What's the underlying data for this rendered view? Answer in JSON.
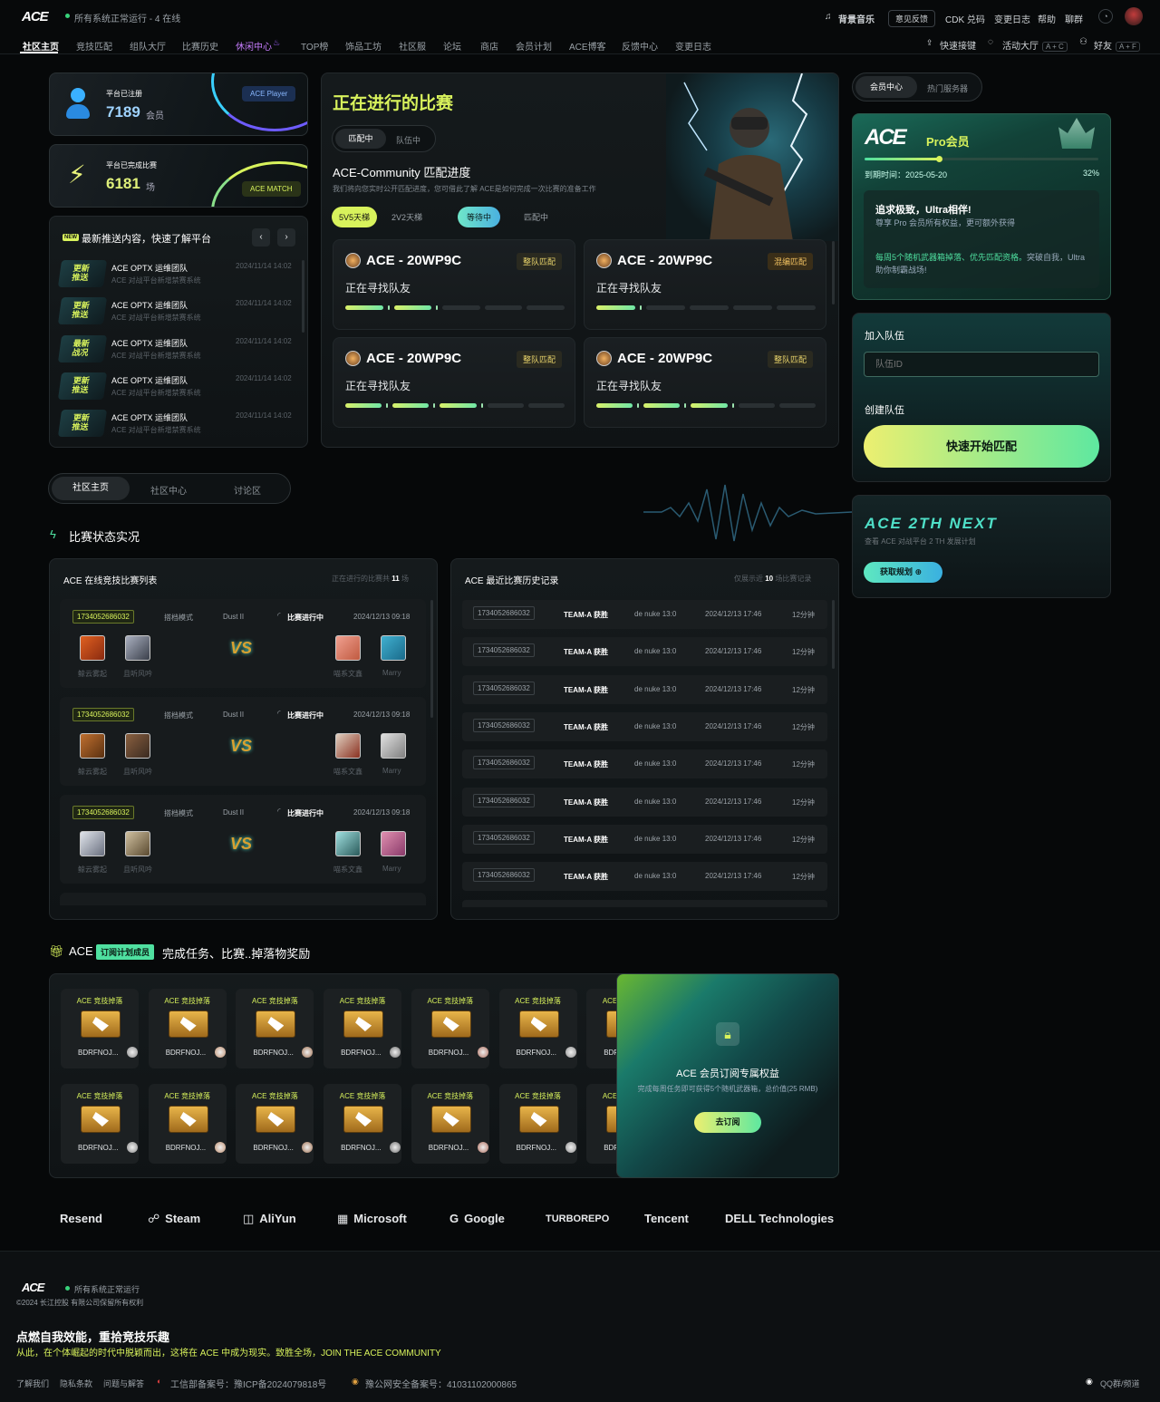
{
  "header": {
    "logo": "ACE",
    "status": "所有系统正常运行 - 4 在线",
    "music": "背景音乐",
    "feedback": "意见反馈",
    "cdk": "CDK 兑码",
    "changelog": "变更日志",
    "help": "帮助",
    "chat": "聊群",
    "shortcut": "快速接键",
    "lobby": "活动大厅",
    "lobby_key": "A + C",
    "friends": "好友",
    "friends_key": "A + F",
    "nav": [
      "社区主页",
      "竞技匹配",
      "组队大厅",
      "比赛历史",
      "休闲中心",
      "TOP榜",
      "饰品工坊",
      "社区服",
      "论坛",
      "商店",
      "会员计划",
      "ACE博客",
      "反馈中心",
      "变更日志"
    ]
  },
  "stats": {
    "registered_label": "平台已注册",
    "registered_value": "7189",
    "registered_unit": "会员",
    "registered_tag": "ACE Player",
    "matches_label": "平台已完成比赛",
    "matches_value": "6181",
    "matches_unit": "场",
    "matches_tag": "ACE MATCH"
  },
  "news": {
    "new_badge": "NEW",
    "title": "最新推送内容，快速了解平台",
    "items": [
      {
        "thumb": "更新推送",
        "org": "ACE OPTX 运维团队",
        "desc": "ACE 对战平台新增禁赛系统",
        "date": "2024/11/14 14:02"
      },
      {
        "thumb": "更新推送",
        "org": "ACE OPTX 运维团队",
        "desc": "ACE 对战平台新增禁赛系统",
        "date": "2024/11/14 14:02"
      },
      {
        "thumb": "最新战况",
        "org": "ACE OPTX 运维团队",
        "desc": "ACE 对战平台新增禁赛系统",
        "date": "2024/11/14 14:02"
      },
      {
        "thumb": "更新推送",
        "org": "ACE OPTX 运维团队",
        "desc": "ACE 对战平台新增禁赛系统",
        "date": "2024/11/14 14:02"
      },
      {
        "thumb": "更新推送",
        "org": "ACE OPTX 运维团队",
        "desc": "ACE 对战平台新增禁赛系统",
        "date": "2024/11/14 14:02"
      }
    ]
  },
  "live": {
    "title": "正在进行的比赛",
    "tab1": "匹配中",
    "tab2": "队伍中",
    "subtitle": "ACE-Community 匹配进度",
    "desc": "我们将向您实时公开匹配进度，您可借此了解 ACE是如何完成一次比赛的准备工作",
    "mode1": "5V5天梯",
    "mode2": "2V2天梯",
    "state1": "等待中",
    "state2": "匹配中",
    "cards": [
      {
        "title": "ACE - 20WP9C",
        "badge": "整队匹配",
        "sub": "正在寻找队友",
        "on": [
          1,
          1,
          0,
          0,
          0
        ],
        "ticks": 2
      },
      {
        "title": "ACE - 20WP9C",
        "badge": "混编匹配",
        "sub": "正在寻找队友",
        "on": [
          1,
          0,
          0,
          0,
          0
        ],
        "ticks": 1
      },
      {
        "title": "ACE - 20WP9C",
        "badge": "整队匹配",
        "sub": "正在寻找队友",
        "on": [
          1,
          1,
          1,
          0,
          0
        ],
        "ticks": 3
      },
      {
        "title": "ACE - 20WP9C",
        "badge": "整队匹配",
        "sub": "正在寻找队友",
        "on": [
          1,
          1,
          1,
          0,
          0
        ],
        "ticks": 3
      }
    ]
  },
  "side": {
    "tab1": "会员中心",
    "tab2": "热门服务器",
    "pro_label": "Pro会员",
    "expire": "到期时间：2025-05-20",
    "percent": "32%",
    "progress": 0.32,
    "promo_title": "追求极致，Ultra相伴!",
    "promo_desc": "尊享 Pro 会员所有权益，更可额外获得",
    "promo_hl": "每周5个随机武器箱掉落、优先匹配资格。",
    "promo_tail": "突破自我，Ultra助你制霸战场!",
    "join_label": "加入队伍",
    "team_placeholder": "队伍ID",
    "create_label": "创建队伍",
    "quick_btn": "快速开始匹配",
    "next_title": "ACE 2TH NEXT",
    "next_desc": "查看 ACE 对战平台 2 TH 发展计划",
    "next_btn": "获取规划"
  },
  "tabs": [
    "社区主页",
    "社区中心",
    "讨论区"
  ],
  "section_title": "比赛状态实况",
  "online_list": {
    "title": "ACE 在线竞技比赛列表",
    "count_prefix": "正在进行的比赛共",
    "count": "11",
    "count_suffix": "场",
    "rows": [
      {
        "id": "1734052686032",
        "mode": "搭档模式",
        "map": "Dust II",
        "state": "比赛进行中",
        "time": "2024/12/13 09:18",
        "p1": "鲸云雾起",
        "p2": "且听风吟",
        "p3": "喵系文鑫",
        "p4": "Marry"
      },
      {
        "id": "1734052686032",
        "mode": "搭档模式",
        "map": "Dust II",
        "state": "比赛进行中",
        "time": "2024/12/13 09:18",
        "p1": "鲸云雾起",
        "p2": "且听风吟",
        "p3": "喵系文鑫",
        "p4": "Marry"
      },
      {
        "id": "1734052686032",
        "mode": "搭档模式",
        "map": "Dust II",
        "state": "比赛进行中",
        "time": "2024/12/13 09:18",
        "p1": "鲸云雾起",
        "p2": "且听风吟",
        "p3": "喵系文鑫",
        "p4": "Marry"
      }
    ]
  },
  "history": {
    "title": "ACE 最近比赛历史记录",
    "prefix": "仅展示近",
    "count": "10",
    "suffix": "场比赛记录",
    "rows": [
      {
        "id": "1734052686032",
        "winner": "TEAM-A 获胜",
        "map": "de nuke 13:0",
        "time": "2024/12/13 17:46",
        "dur": "12分钟"
      },
      {
        "id": "1734052686032",
        "winner": "TEAM-A 获胜",
        "map": "de nuke 13:0",
        "time": "2024/12/13 17:46",
        "dur": "12分钟"
      },
      {
        "id": "1734052686032",
        "winner": "TEAM-A 获胜",
        "map": "de nuke 13:0",
        "time": "2024/12/13 17:46",
        "dur": "12分钟"
      },
      {
        "id": "1734052686032",
        "winner": "TEAM-A 获胜",
        "map": "de nuke 13:0",
        "time": "2024/12/13 17:46",
        "dur": "12分钟"
      },
      {
        "id": "1734052686032",
        "winner": "TEAM-A 获胜",
        "map": "de nuke 13:0",
        "time": "2024/12/13 17:46",
        "dur": "12分钟"
      },
      {
        "id": "1734052686032",
        "winner": "TEAM-A 获胜",
        "map": "de nuke 13:0",
        "time": "2024/12/13 17:46",
        "dur": "12分钟"
      },
      {
        "id": "1734052686032",
        "winner": "TEAM-A 获胜",
        "map": "de nuke 13:0",
        "time": "2024/12/13 17:46",
        "dur": "12分钟"
      },
      {
        "id": "1734052686032",
        "winner": "TEAM-A 获胜",
        "map": "de nuke 13:0",
        "time": "2024/12/13 17:46",
        "dur": "12分钟"
      }
    ]
  },
  "drops": {
    "prefix": "ACE",
    "badge": "订阅计划成员",
    "title": "完成任务、比赛..掉落物奖励",
    "item_title": "ACE 竞技掉落",
    "item_name": "BDRFNOJ...",
    "lock_title": "ACE 会员订阅专属权益",
    "lock_desc": "完成每周任务即可获得5个随机武器箱，总价值(25 RMB)",
    "lock_btn": "去订阅"
  },
  "brands": [
    "Resend",
    "Steam",
    "AliYun",
    "Microsoft",
    "Google",
    "TURBOREPO",
    "Tencent",
    "DELL Technologies"
  ],
  "footer": {
    "logo": "ACE",
    "status": "所有系统正常运行",
    "copyright": "©2024 长江控股 有限公司保留所有权利",
    "slogan": "点燃自我效能，重拾竞技乐趣",
    "slogan2": "从此，在个体崛起的时代中脱颖而出，这将在 ACE 中成为现实。致胜全场，JOIN THE ACE COMMUNITY",
    "links": [
      "了解我们",
      "隐私条款",
      "问题与解答"
    ],
    "icp": "工信部备案号：豫ICP备2024079818号",
    "police": "豫公网安全备案号：41031102000865",
    "qq": "QQ群/频道"
  },
  "colors": {
    "accent": "#4fe0a0",
    "lime": "#d8f25c",
    "bg": "#060809"
  }
}
